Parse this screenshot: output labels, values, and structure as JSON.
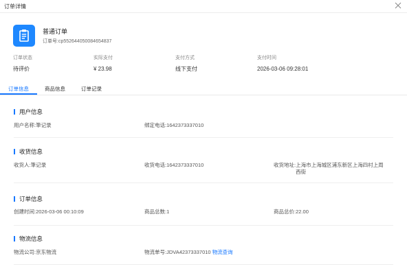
{
  "dialog": {
    "title": "订单详情",
    "close_icon": "close-icon"
  },
  "order": {
    "icon": "clipboard-icon",
    "icon_color": "#1e88ff",
    "type": "普通订单",
    "no_label": "订单号:",
    "no_value": "cp552644050084654837"
  },
  "summary": [
    {
      "label": "订单状态",
      "value": "待评价"
    },
    {
      "label": "实际支付",
      "value": "¥ 23.98"
    },
    {
      "label": "支付方式",
      "value": "线下支付"
    },
    {
      "label": "支付时间",
      "value": "2026-03-06 09:28:01"
    }
  ],
  "tabs": [
    {
      "label": "订单信息",
      "active": true
    },
    {
      "label": "商品信息",
      "active": false
    },
    {
      "label": "订单记录",
      "active": false
    }
  ],
  "accent_color": "#1677ff",
  "sections": {
    "user": {
      "title": "用户信息",
      "name_label": "用户名称:",
      "name_value": "筆记录",
      "phone_label": "绑定电话:",
      "phone_value": "1642373337010"
    },
    "shipping": {
      "title": "收货信息",
      "receiver_label": "收货人:",
      "receiver_value": "筆记录",
      "phone_label": "收货电话:",
      "phone_value": "1642373337010",
      "address_label": "收货地址:",
      "address_value": "上海市上海城区浦东新区上海四村上周西街"
    },
    "order": {
      "title": "订单信息",
      "created_label": "创建时间:",
      "created_value": "2026-03-06 00:10:09",
      "qty_label": "商品总数:",
      "qty_value": "1",
      "total_label": "商品总价:",
      "total_value": "22.00"
    },
    "logistics": {
      "title": "物流信息",
      "company_label": "物流公司:",
      "company_value": "京东物流",
      "tracking_label": "物流单号:",
      "tracking_value": "JDVA42373337010",
      "query_link": "物流查询"
    }
  }
}
